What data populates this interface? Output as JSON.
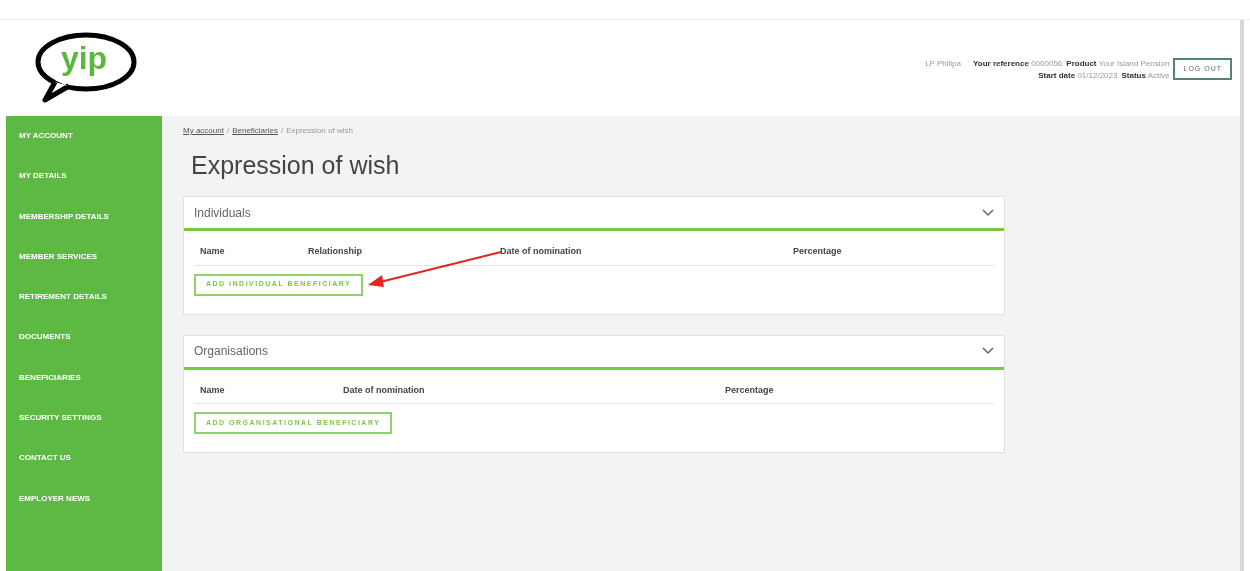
{
  "logo": {
    "text": "yip"
  },
  "header": {
    "user": "LP Philipa",
    "fields": [
      {
        "label": "Your reference",
        "value": "0000056"
      },
      {
        "label": "Product",
        "value": "Your Island Pension"
      },
      {
        "label": "Start date",
        "value": "01/12/2023"
      },
      {
        "label": "Status",
        "value": "Active"
      }
    ],
    "logout": "LOG OUT"
  },
  "sidebar": {
    "items": [
      {
        "label": "MY ACCOUNT"
      },
      {
        "label": "MY DETAILS"
      },
      {
        "label": "MEMBERSHIP DETAILS"
      },
      {
        "label": "MEMBER SERVICES"
      },
      {
        "label": "RETIREMENT DETAILS"
      },
      {
        "label": "DOCUMENTS"
      },
      {
        "label": "BENEFICIARIES"
      },
      {
        "label": "SECURITY SETTINGS"
      },
      {
        "label": "CONTACT US"
      },
      {
        "label": "EMPLOYER NEWS"
      }
    ]
  },
  "breadcrumb": [
    {
      "kind": "link",
      "label": "My account"
    },
    {
      "kind": "separator",
      "label": "/"
    },
    {
      "kind": "link",
      "label": "Beneficiaries"
    },
    {
      "kind": "separator",
      "label": "/"
    },
    {
      "kind": "current",
      "label": "Expression of wish"
    }
  ],
  "page_title": "Expression of wish",
  "sections": [
    {
      "title": "Individuals",
      "expanded": true,
      "columns": [
        "Name",
        "Relationship",
        "Date of nomination",
        "Percentage"
      ],
      "button": "ADD INDIVIDUAL BENEFICIARY",
      "annotated": true
    },
    {
      "title": "Organisations",
      "expanded": true,
      "columns": [
        "Name",
        "Date of nomination",
        "Percentage"
      ],
      "button": "ADD ORGANISATIONAL BENEFICIARY",
      "annotated": false
    }
  ]
}
